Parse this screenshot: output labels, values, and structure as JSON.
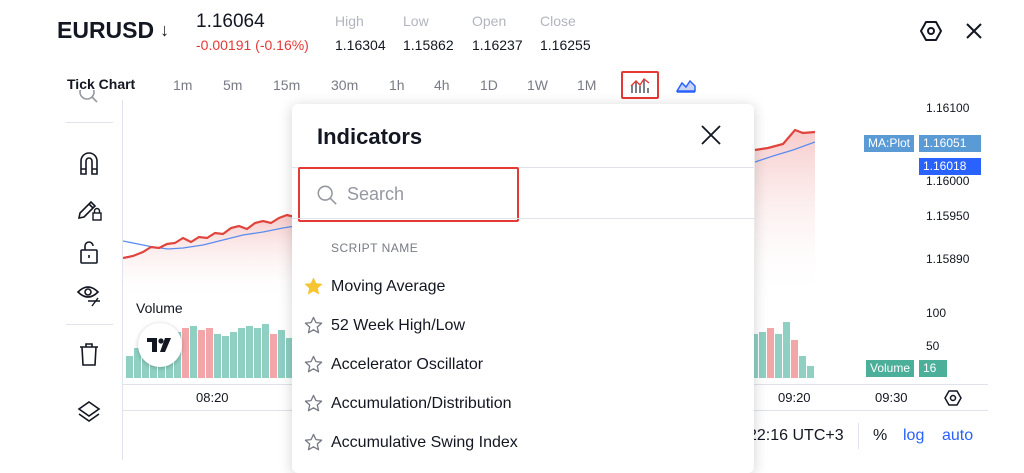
{
  "header": {
    "symbol": "EURUSD",
    "symbol_arrow": "↓",
    "price": "1.16064",
    "change": "-0.00191 (-0.16%)",
    "ohlc": [
      {
        "label": "High",
        "value": "1.16304"
      },
      {
        "label": "Low",
        "value": "1.15862"
      },
      {
        "label": "Open",
        "value": "1.16237"
      },
      {
        "label": "Close",
        "value": "1.16255"
      }
    ],
    "settings_icon": "settings-hexagon-icon",
    "close_icon": "close-icon"
  },
  "timeframes": {
    "tick_label": "Tick Chart",
    "items": [
      "1m",
      "5m",
      "15m",
      "30m",
      "1h",
      "4h",
      "1D",
      "1W",
      "1M"
    ],
    "chart_type_icon": "indicators-chart-icon",
    "area_icon": "area-chart-icon"
  },
  "left_toolbar": [
    "magnifier-icon",
    "magnet-icon",
    "pencil-lock-icon",
    "unlock-icon",
    "eye-icon",
    "trash-icon",
    "layers-icon"
  ],
  "chart": {
    "volume_label": "Volume",
    "price_labels": [
      "1.16100",
      "1.16000",
      "1.15950",
      "1.15890"
    ],
    "ma_badge_label": "MA:Plot",
    "ma_badge_value": "1.16051",
    "price_badge_value": "1.16018",
    "volume_ticks": [
      "100",
      "50"
    ],
    "volume_badge_label": "Volume",
    "volume_badge_value": "16",
    "time_labels": [
      "08:20",
      "09:20",
      "09:30"
    ],
    "colors": {
      "price_line": "#e0443c",
      "ma_line": "#5b8def",
      "vol_up": "#8fd0c3",
      "vol_down": "#f2a6aa",
      "ma_badge": "#5b9bd5",
      "price_badge": "#2962ff",
      "vol_badge": "#4caf9a"
    }
  },
  "bottom_bar": {
    "time": "22:16 UTC+3",
    "percent": "%",
    "log": "log",
    "auto": "auto"
  },
  "dialog": {
    "title": "Indicators",
    "search_placeholder": "Search",
    "column_header": "SCRIPT NAME",
    "items": [
      {
        "name": "Moving Average",
        "favorite": true
      },
      {
        "name": "52 Week High/Low",
        "favorite": false
      },
      {
        "name": "Accelerator Oscillator",
        "favorite": false
      },
      {
        "name": "Accumulation/Distribution",
        "favorite": false
      },
      {
        "name": "Accumulative Swing Index",
        "favorite": false
      }
    ]
  }
}
